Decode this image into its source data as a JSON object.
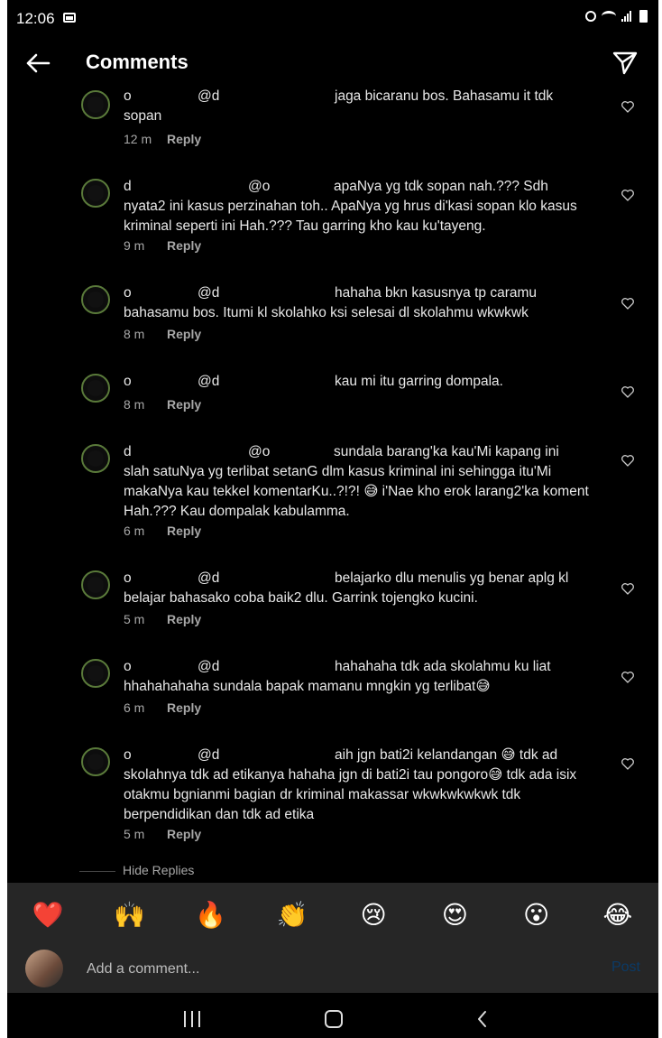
{
  "status": {
    "time": "12:06"
  },
  "header": {
    "title": "Comments"
  },
  "comments": [
    {
      "user": "o",
      "mention": "@d",
      "text_line1": "jaga bicaranu bos. Bahasamu it tdk",
      "rest": "sopan",
      "time": "12 m",
      "reply": "Reply"
    },
    {
      "user": "d",
      "mention": "@o",
      "text_line1": "apaNya yg tdk sopan nah.??? Sdh",
      "rest": "nyata2 ini kasus perzinahan toh.. ApaNya yg hrus di'kasi sopan klo kasus kriminal seperti ini Hah.??? Tau garring kho kau ku'tayeng.",
      "time": "9 m",
      "reply": "Reply"
    },
    {
      "user": "o",
      "mention": "@d",
      "text_line1": "hahaha bkn kasusnya tp caramu",
      "rest": "bahasamu bos. Itumi kl skolahko ksi selesai dl skolahmu wkwkwk",
      "time": "8 m",
      "reply": "Reply"
    },
    {
      "user": "o",
      "mention": "@d",
      "text_line1": "kau mi itu garring dompala.",
      "rest": "",
      "time": "8 m",
      "reply": "Reply"
    },
    {
      "user": "d",
      "mention": "@o",
      "text_line1": "sundala barang'ka kau'Mi kapang ini",
      "rest": "slah satuNya yg terlibat setanG dlm kasus kriminal ini sehingga itu'Mi makaNya kau tekkel komentarKu..?!?! 😅 i'Nae kho erok larang2'ka koment Hah.??? Kau dompalak kabulamma.",
      "time": "6 m",
      "reply": "Reply"
    },
    {
      "user": "o",
      "mention": "@d",
      "text_line1": "belajarko dlu menulis yg benar aplg kl",
      "rest": "belajar bahasako coba baik2 dlu. Garrink tojengko kucini.",
      "time": "5 m",
      "reply": "Reply"
    },
    {
      "user": "o",
      "mention": "@d",
      "text_line1": "hahahaha tdk ada skolahmu ku liat",
      "rest": "hhahahahaha sundala bapak mamanu mngkin yg terlibat😅",
      "time": "6 m",
      "reply": "Reply"
    },
    {
      "user": "o",
      "mention": "@d",
      "text_line1": "aih jgn bati2i kelandangan 😅 tdk ad",
      "rest": "skolahnya tdk ad etikanya hahaha jgn di bati2i tau pongoro😅 tdk ada isix otakmu bgnianmi bagian dr kriminal makassar wkwkwkwkwk tdk berpendidikan dan tdk ad etika",
      "time": "5 m",
      "reply": "Reply"
    }
  ],
  "hide_replies": "Hide Replies",
  "reactions": [
    "❤️",
    "🙌",
    "🔥",
    "👏",
    "😢",
    "😍",
    "😮",
    "😂"
  ],
  "input": {
    "placeholder": "Add a comment...",
    "post_label": "Post"
  },
  "colors": {
    "background": "#000000",
    "panel": "#262626",
    "muted": "#a8a8a8",
    "post_disabled": "#0b3a66"
  }
}
